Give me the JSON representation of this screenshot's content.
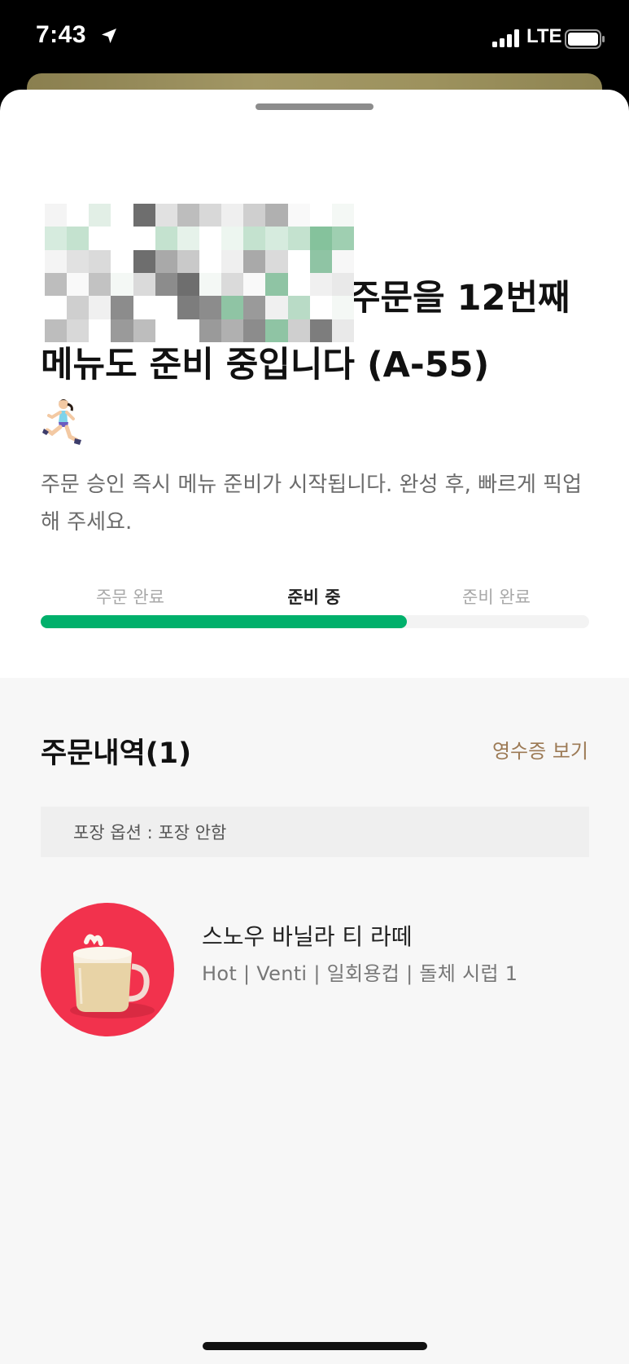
{
  "status_bar": {
    "time": "7:43",
    "network": "LTE",
    "location_icon": "location-arrow-icon",
    "signal_icon": "cellular-signal-icon",
    "battery_icon": "battery-icon"
  },
  "order_status": {
    "headline_line1": "주문을 12번째",
    "headline_line2": "메뉴도 준비 중입니다 (A-55)",
    "runner_icon": "woman-running-emoji-icon",
    "description": "주문 승인 즉시 메뉴 준비가 시작됩니다. 완성 후, 빠르게 픽업해 주세요.",
    "steps": [
      {
        "label": "주문 완료",
        "active": false
      },
      {
        "label": "준비 중",
        "active": true
      },
      {
        "label": "준비 완료",
        "active": false
      }
    ],
    "progress_fraction": 0.667,
    "accent_color": "#00b06b"
  },
  "order_history": {
    "title": "주문내역(1)",
    "receipt_link": "영수증 보기",
    "packaging_option": "포장 옵션 : 포장 안함",
    "items": [
      {
        "name": "스노우 바닐라 티 라떼",
        "options": "Hot | Venti | 일회용컵 | 돌체 시럽 1",
        "image_icon": "latte-cup-image"
      }
    ]
  },
  "colors": {
    "link": "#9c7a55",
    "item_background": "#f2324d"
  }
}
